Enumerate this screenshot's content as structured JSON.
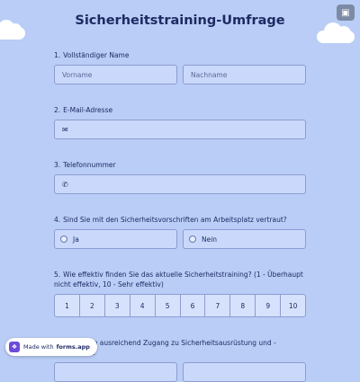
{
  "form": {
    "title": "Sicherheitstraining-Umfrage"
  },
  "questions": [
    {
      "num": "1.",
      "label": "Vollständiger Name",
      "first_placeholder": "Vorname",
      "last_placeholder": "Nachname"
    },
    {
      "num": "2.",
      "label": "E-Mail-Adresse",
      "icon": "mail-icon"
    },
    {
      "num": "3.",
      "label": "Telefonnummer",
      "icon": "phone-icon"
    },
    {
      "num": "4.",
      "label": "Sind Sie mit den Sicherheitsvorschriften am Arbeitsplatz vertraut?",
      "options": [
        "Ja",
        "Nein"
      ]
    },
    {
      "num": "5.",
      "label": "Wie effektiv finden Sie das aktuelle Sicherheitstraining? (1 - Überhaupt nicht effektiv, 10 - Sehr effektiv)",
      "scale": [
        "1",
        "2",
        "3",
        "4",
        "5",
        "6",
        "7",
        "8",
        "9",
        "10"
      ]
    },
    {
      "num": "6.",
      "label": "Haben Sie ausreichend Zugang zu Sicherheitsausrüstung und -materialien?"
    }
  ],
  "badge": {
    "prefix": "Made with",
    "brand": "forms.app"
  },
  "colors": {
    "background": "#b9cdf6",
    "input_bg": "#cad9fb",
    "border": "#8d9bd1",
    "text": "#1f2a63"
  }
}
